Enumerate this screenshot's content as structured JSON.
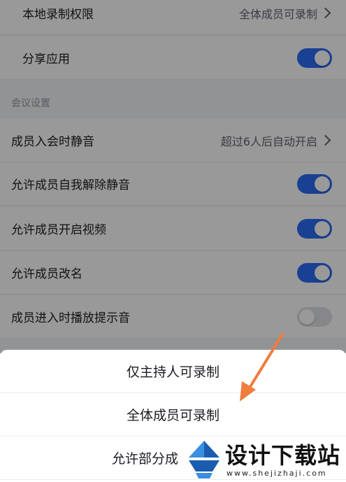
{
  "settings": {
    "local_record": {
      "label": "本地录制权限",
      "value": "全体成员可录制"
    },
    "share_app": {
      "label": "分享应用",
      "enabled": true
    },
    "section_title": "会议设置",
    "mute_on_join": {
      "label": "成员入会时静音",
      "value": "超过6人后自动开启"
    },
    "allow_unmute": {
      "label": "允许成员自我解除静音",
      "enabled": true
    },
    "allow_video": {
      "label": "允许成员开启视频",
      "enabled": true
    },
    "allow_rename": {
      "label": "允许成员改名",
      "enabled": true
    },
    "join_sound": {
      "label": "成员进入时播放提示音",
      "enabled": false
    }
  },
  "sheet": {
    "options": [
      "仅主持人可录制",
      "全体成员可录制",
      "允许部分成"
    ]
  },
  "annotation": {
    "arrow_color": "#f07c3e"
  },
  "watermark": {
    "title": "设计下载站",
    "subtitle": "www.shejizhaji.com"
  },
  "colors": {
    "toggle_on": "#2a6cf6",
    "toggle_off": "#dfe1e6"
  }
}
